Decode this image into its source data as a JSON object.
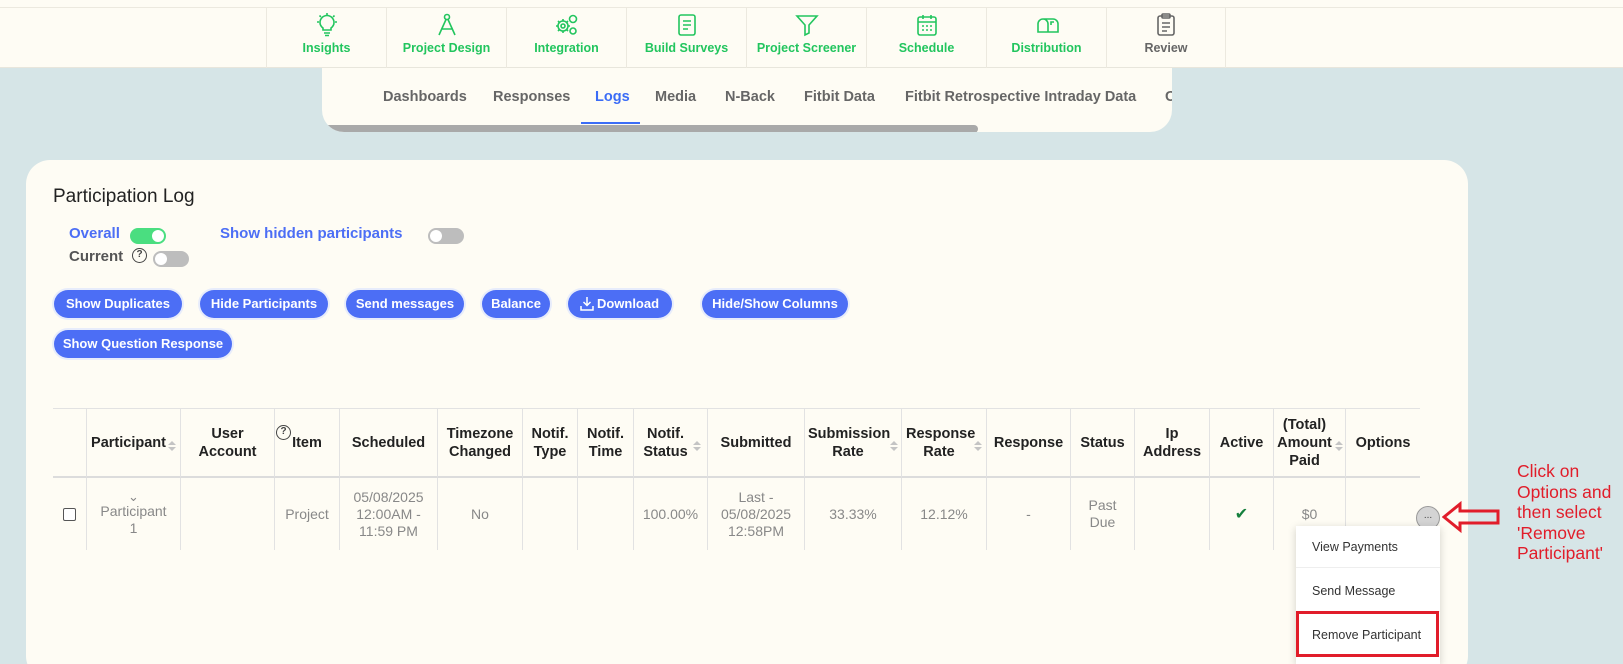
{
  "top_nav": {
    "items": [
      {
        "label": "Insights",
        "icon": "lightbulb-icon"
      },
      {
        "label": "Project Design",
        "icon": "compass-icon"
      },
      {
        "label": "Integration",
        "icon": "gears-icon"
      },
      {
        "label": "Build Surveys",
        "icon": "document-icon"
      },
      {
        "label": "Project Screener",
        "icon": "filter-icon"
      },
      {
        "label": "Schedule",
        "icon": "calendar-icon"
      },
      {
        "label": "Distribution",
        "icon": "mailbox-icon"
      },
      {
        "label": "Review",
        "icon": "clipboard-icon"
      }
    ]
  },
  "sub_tabs": {
    "items": [
      "Dashboards",
      "Responses",
      "Logs",
      "Media",
      "N-Back",
      "Fitbit Data",
      "Fitbit Retrospective Intraday Data",
      "C"
    ],
    "active": "Logs"
  },
  "card": {
    "title": "Participation Log",
    "toggles": {
      "overall": {
        "label": "Overall",
        "on": true
      },
      "current": {
        "label": "Current",
        "on": false
      },
      "hidden": {
        "label": "Show hidden participants",
        "on": false
      }
    },
    "help_glyph": "?",
    "buttons": {
      "show_duplicates": "Show Duplicates",
      "hide_participants": "Hide Participants",
      "send_messages": "Send messages",
      "balance": "Balance",
      "download": "Download",
      "hide_show_columns": "Hide/Show Columns",
      "show_question_response": "Show Question Response"
    }
  },
  "table": {
    "headers": {
      "participant": "Participant",
      "user_account": "User Account",
      "item": "Item",
      "scheduled": "Scheduled",
      "timezone": "Timezone Changed",
      "notif_type": "Notif. Type",
      "notif_time": "Notif. Time",
      "notif_status": "Notif. Status",
      "submitted": "Submitted",
      "submission_rate": "Submission Rate",
      "response_rate": "Response Rate",
      "response": "Response",
      "status": "Status",
      "ip": "Ip Address",
      "active": "Active",
      "amount": "(Total) Amount Paid",
      "options": "Options"
    },
    "row": {
      "expand_glyph": "⌄",
      "participant": "Participant 1",
      "user_account": "",
      "item": "Project",
      "scheduled": "05/08/2025 12:00AM - 11:59 PM",
      "timezone": "No",
      "notif_type": "",
      "notif_time": "",
      "notif_status": "100.00%",
      "submitted": "Last - 05/08/2025 12:58PM",
      "submission_rate": "33.33%",
      "response_rate": "12.12%",
      "response": "-",
      "status": "Past Due",
      "ip": "",
      "active_glyph": "✔",
      "amount": "$0",
      "options_glyph": "..."
    }
  },
  "options_menu": {
    "items": [
      "View Payments",
      "Send Message",
      "Remove Participant"
    ],
    "highlighted": "Remove Participant"
  },
  "annotation": {
    "text": "Click on Options and then select 'Remove Participant'",
    "color": "#e11d2a"
  },
  "colors": {
    "accent_green": "#22c55e",
    "accent_blue": "#4c6ef5",
    "background": "#d6e5e7"
  }
}
